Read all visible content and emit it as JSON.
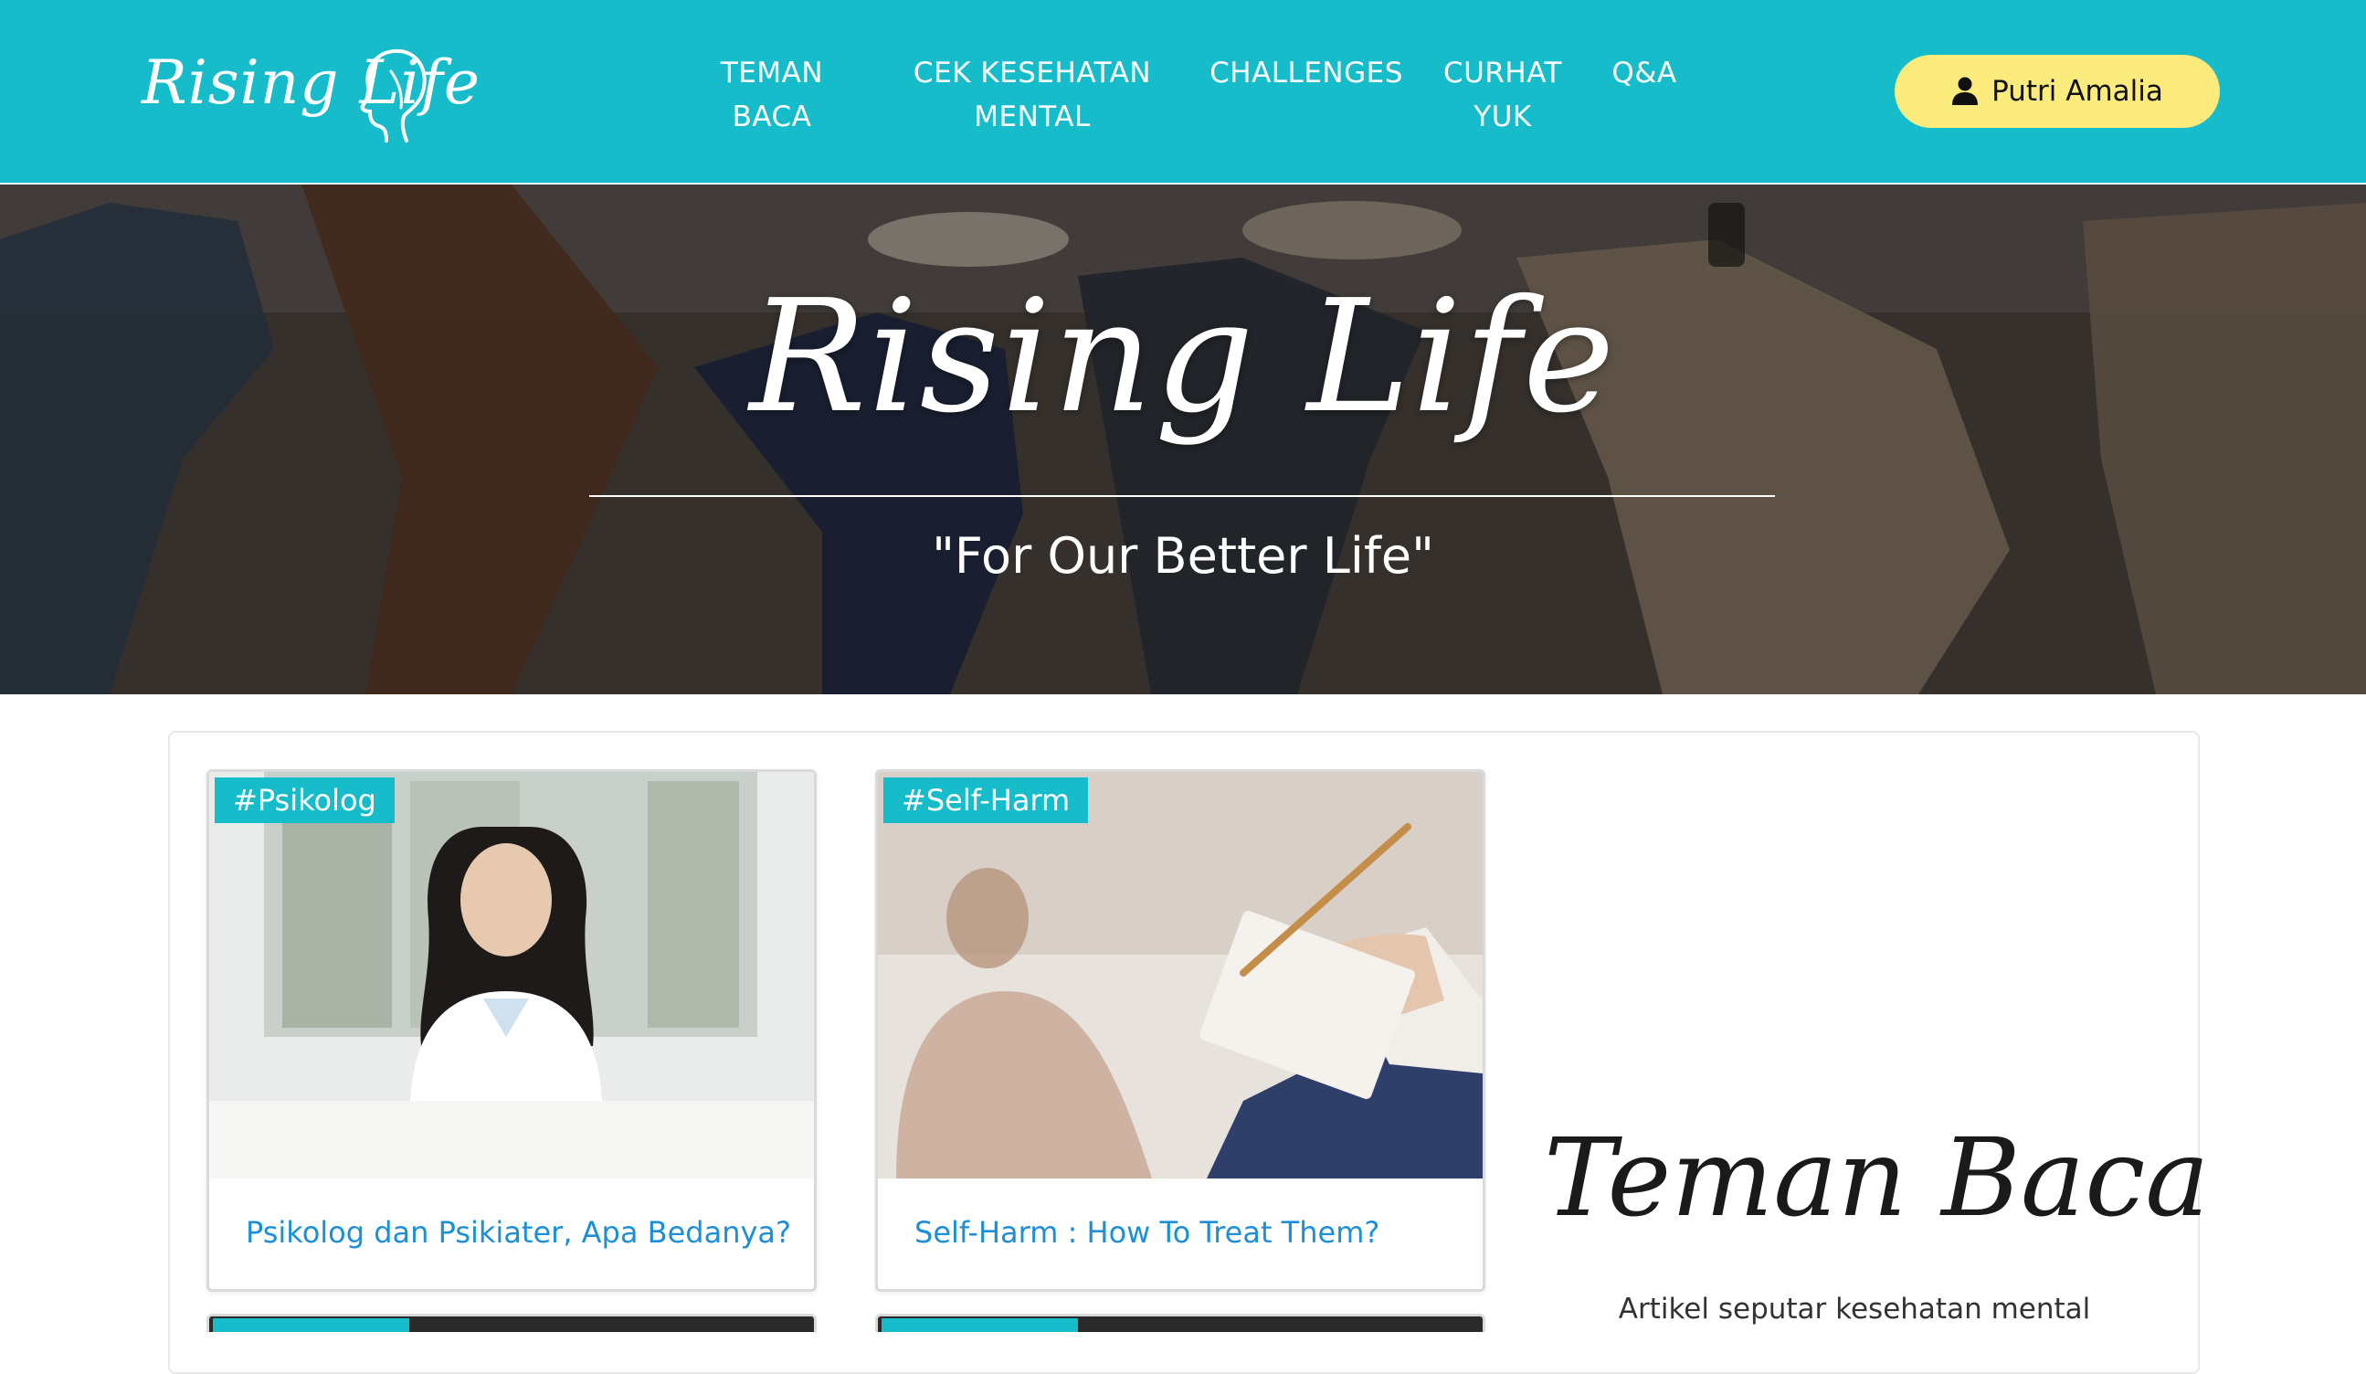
{
  "brand": {
    "logo_text": "Rising Life"
  },
  "nav": {
    "items": [
      {
        "label": "TEMAN BACA",
        "lines": [
          "TEMAN",
          "BACA"
        ]
      },
      {
        "label": "CEK KESEHATAN MENTAL",
        "lines": [
          "CEK KESEHATAN",
          "MENTAL"
        ]
      },
      {
        "label": "CHALLENGES",
        "lines": [
          "CHALLENGES"
        ]
      },
      {
        "label": "CURHAT YUK",
        "lines": [
          "CURHAT",
          "YUK"
        ]
      },
      {
        "label": "Q&A",
        "lines": [
          "Q&A"
        ]
      }
    ],
    "user_name": "Putri Amalia",
    "user_icon": "user-icon"
  },
  "hero": {
    "title": "Rising Life",
    "tagline": "\"For Our Better Life\""
  },
  "articles": [
    {
      "tag": "#Psikolog",
      "title": "Psikolog dan Psikiater, Apa Bedanya?"
    },
    {
      "tag": "#Self-Harm",
      "title": "Self-Harm : How To Treat Them?"
    }
  ],
  "sidebar": {
    "title": "Teman Baca",
    "subtitle": "Artikel seputar kesehatan mental"
  },
  "colors": {
    "primary": "#17bccb",
    "user_button": "#fbeb7c",
    "link": "#1d8fd6"
  }
}
